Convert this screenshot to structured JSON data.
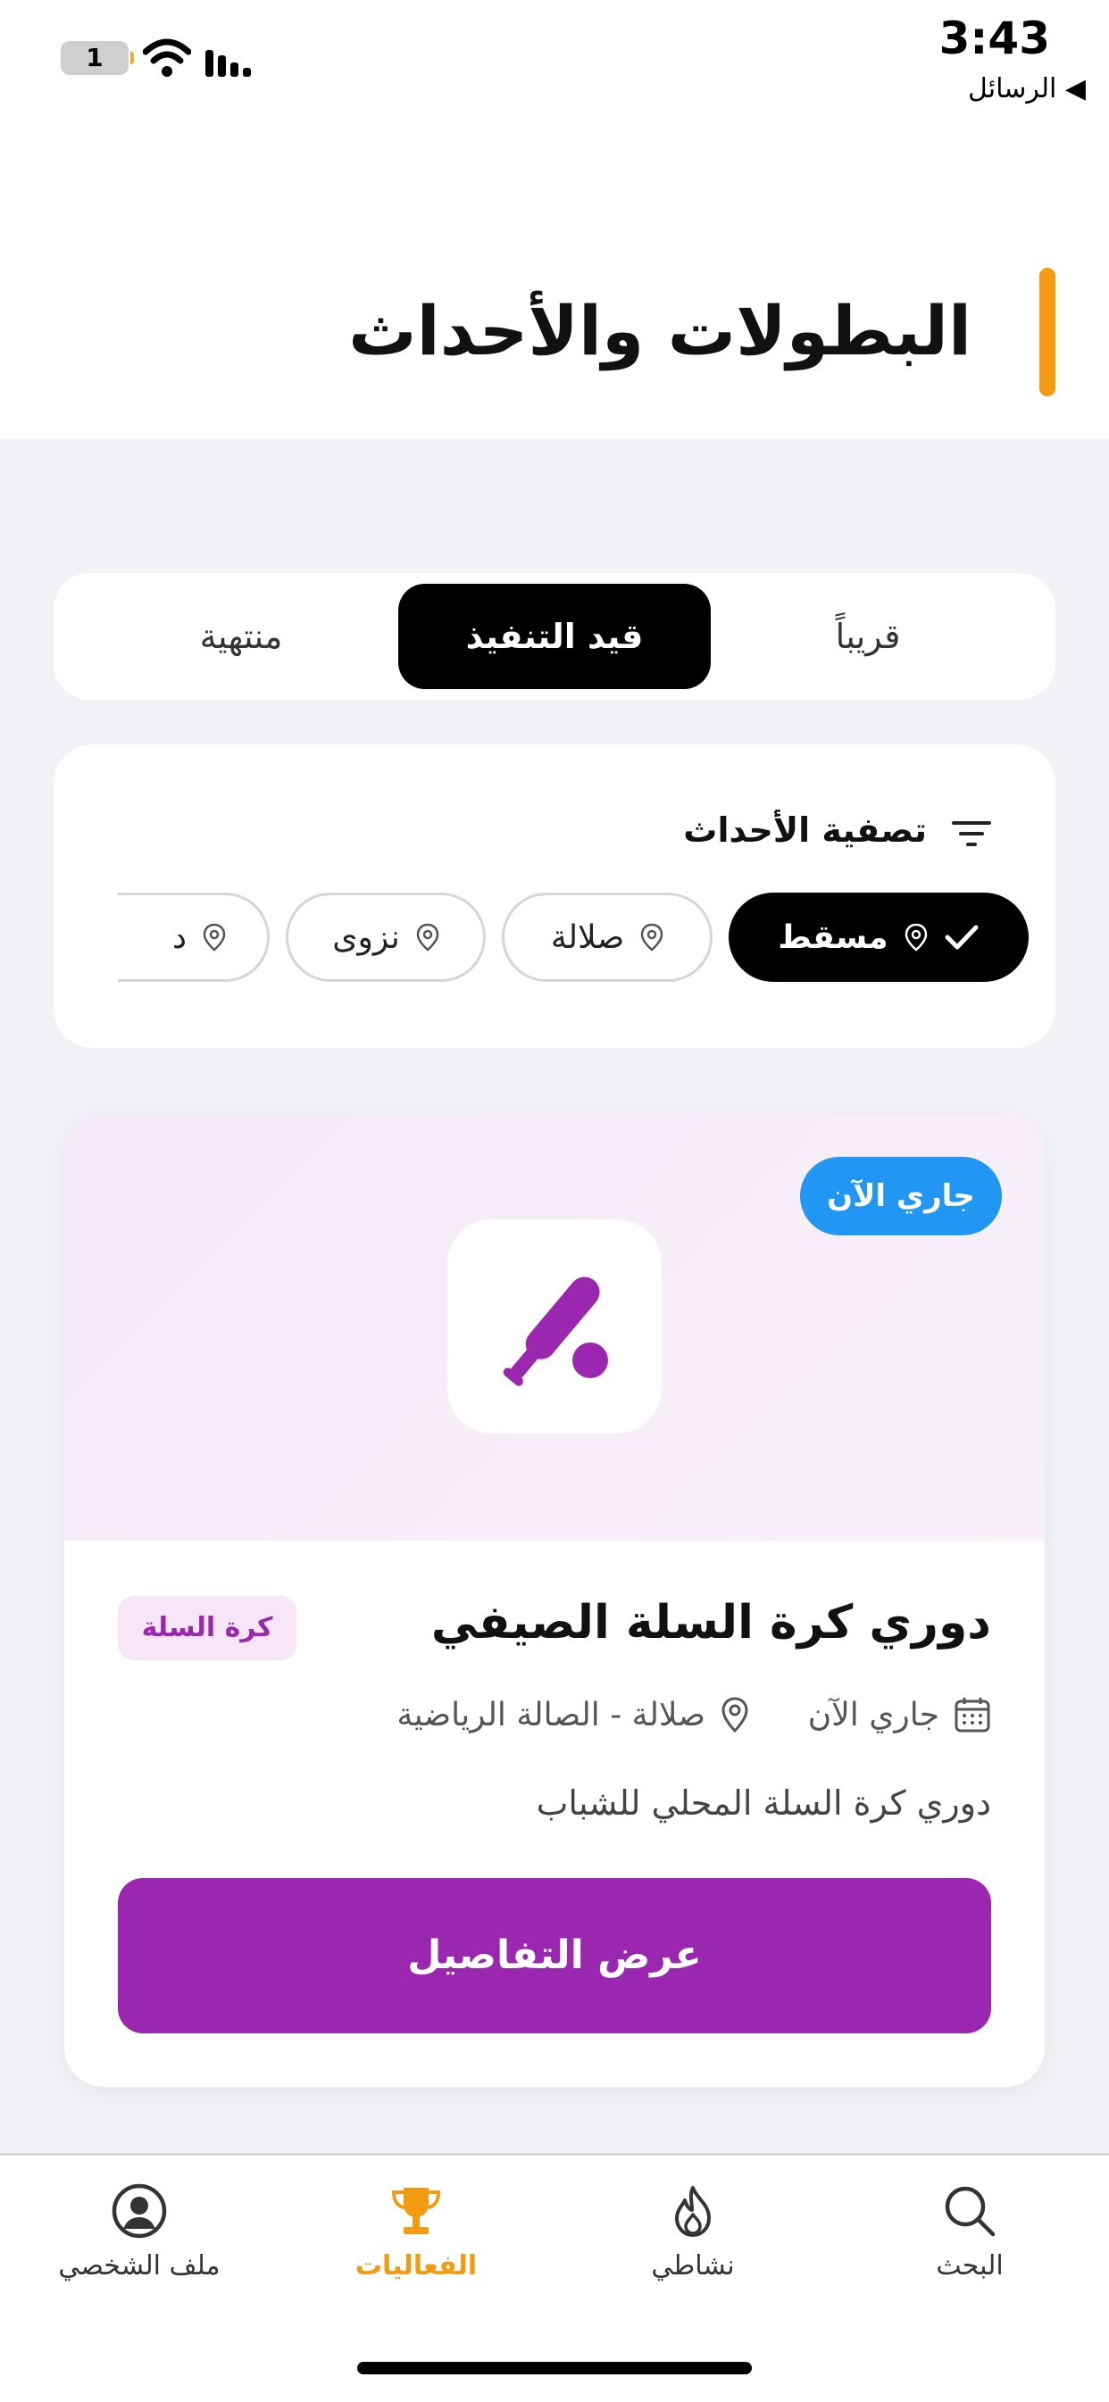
{
  "status_bar": {
    "time": "3:43",
    "back_label": "◀ الرسائل",
    "battery": "1"
  },
  "header": {
    "title": "البطولات والأحداث",
    "accent_color": "#f39c12"
  },
  "tabs": [
    {
      "label": "قريباً",
      "active": false
    },
    {
      "label": "قيد التنفيذ",
      "active": true
    },
    {
      "label": "منتهية",
      "active": false
    }
  ],
  "filter": {
    "title": "تصفية الأحداث",
    "chips": [
      {
        "label": "مسقط",
        "active": true
      },
      {
        "label": "صلالة",
        "active": false
      },
      {
        "label": "نزوى",
        "active": false
      },
      {
        "label": "د",
        "active": false
      }
    ]
  },
  "event": {
    "status_badge": "جاري الآن",
    "title": "دوري كرة السلة الصيفي",
    "tag": "كرة السلة",
    "date": "جاري الآن",
    "location": "صلالة - الصالة الرياضية",
    "description": "دوري كرة السلة المحلي للشباب",
    "cta": "عرض التفاصيل",
    "icon": "sports-bat-ball-icon",
    "brand_color": "#9b27b0",
    "badge_color": "#2196f3"
  },
  "bottom_nav": [
    {
      "label": "البحث",
      "icon": "search-icon",
      "active": false
    },
    {
      "label": "نشاطي",
      "icon": "flame-icon",
      "active": false
    },
    {
      "label": "الفعاليات",
      "icon": "trophy-icon",
      "active": true
    },
    {
      "label": "ملف الشخصي",
      "icon": "profile-icon",
      "active": false
    }
  ]
}
